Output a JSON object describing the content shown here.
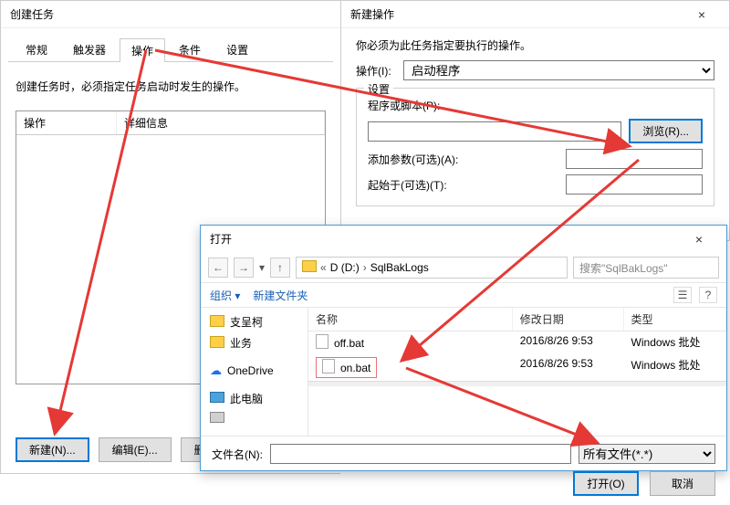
{
  "winA": {
    "title": "创建任务",
    "tabs": [
      "常规",
      "触发器",
      "操作",
      "条件",
      "设置"
    ],
    "active_tab_index": 2,
    "hint": "创建任务时，必须指定任务启动时发生的操作。",
    "list_headers": [
      "操作",
      "详细信息"
    ],
    "buttons": {
      "new": "新建(N)...",
      "edit": "编辑(E)...",
      "delete": "删"
    }
  },
  "winB": {
    "title": "新建操作",
    "close": "×",
    "hint": "你必须为此任务指定要执行的操作。",
    "action_label": "操作(I):",
    "action_value": "启动程序",
    "group_legend": "设置",
    "program_label": "程序或脚本(P):",
    "browse": "浏览(R)...",
    "args_label": "添加参数(可选)(A):",
    "startin_label": "起始于(可选)(T):"
  },
  "winC": {
    "title": "打开",
    "close": "×",
    "crumbs": [
      "«",
      "D (D:)",
      "›",
      "SqlBakLogs"
    ],
    "search_placeholder": "搜索\"SqlBakLogs\"",
    "toolbar": {
      "org": "组织 ▾",
      "newfolder": "新建文件夹"
    },
    "side": [
      {
        "icon": "folder",
        "label": "支呈柯"
      },
      {
        "icon": "folder",
        "label": "业务"
      },
      {
        "icon": "cloud",
        "label": "OneDrive"
      },
      {
        "icon": "pc",
        "label": "此电脑"
      },
      {
        "icon": "drive",
        "label": ""
      }
    ],
    "fhead": [
      "名称",
      "修改日期",
      "类型"
    ],
    "files": [
      {
        "name": "off.bat",
        "date": "2016/8/26 9:53",
        "type": "Windows 批处"
      },
      {
        "name": "on.bat",
        "date": "2016/8/26 9:53",
        "type": "Windows 批处"
      }
    ],
    "filename_label": "文件名(N):",
    "filter": "所有文件(*.*)",
    "open": "打开(O)",
    "cancel": "取消"
  }
}
